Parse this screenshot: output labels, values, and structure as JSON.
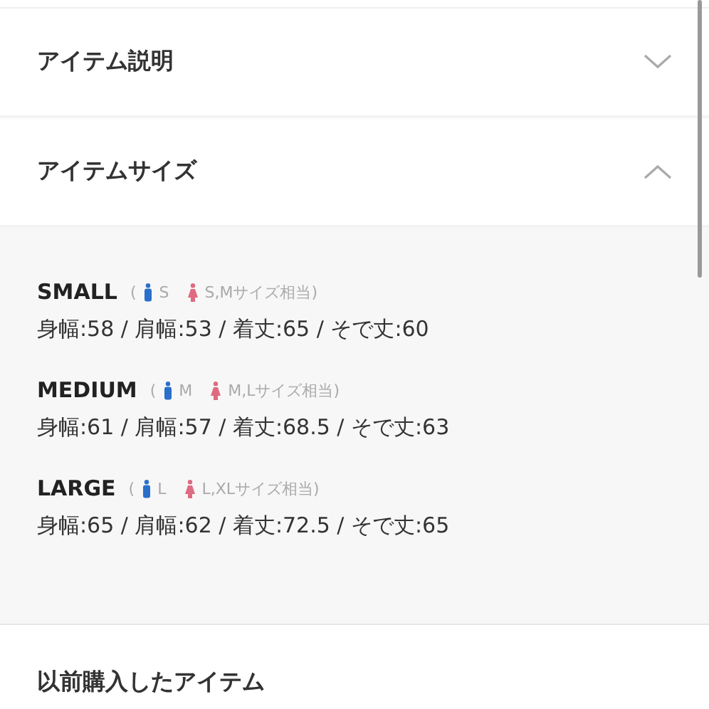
{
  "sections": [
    {
      "title": "アイテム説明",
      "expanded": false
    },
    {
      "title": "アイテムサイズ",
      "expanded": true
    }
  ],
  "sizes": [
    {
      "name": "SMALL",
      "open_paren": "(",
      "male": "S",
      "female": "S,Mサイズ相当)",
      "measurements": "身幅:58 / 肩幅:53 / 着丈:65 / そで丈:60"
    },
    {
      "name": "MEDIUM",
      "open_paren": "(",
      "male": "M",
      "female": "M,Lサイズ相当)",
      "measurements": "身幅:61 / 肩幅:57 / 着丈:68.5 / そで丈:63"
    },
    {
      "name": "LARGE",
      "open_paren": "(",
      "male": "L",
      "female": "L,XLサイズ相当)",
      "measurements": "身幅:65 / 肩幅:62 / 着丈:72.5 / そで丈:65"
    }
  ],
  "next_section": {
    "title": "以前購入したアイテム"
  }
}
